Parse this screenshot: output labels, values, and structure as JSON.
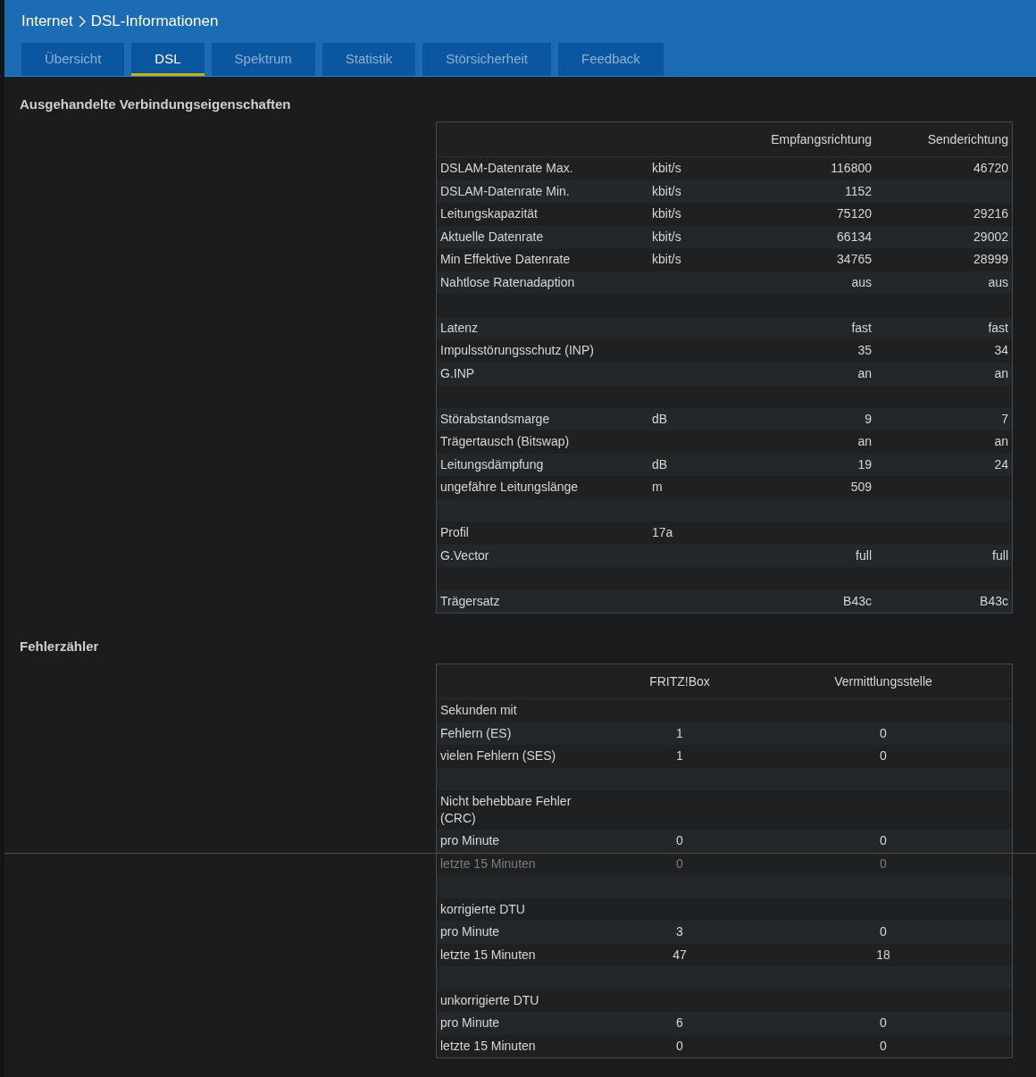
{
  "breadcrumb": {
    "parent": "Internet",
    "current": "DSL-Informationen"
  },
  "tabs": [
    {
      "label": "Übersicht",
      "selected": false
    },
    {
      "label": "DSL",
      "selected": true
    },
    {
      "label": "Spektrum",
      "selected": false
    },
    {
      "label": "Statistik",
      "selected": false
    },
    {
      "label": "Störsicherheit",
      "selected": false
    },
    {
      "label": "Feedback",
      "selected": false
    }
  ],
  "connection": {
    "title": "Ausgehandelte Verbindungseigenschaften",
    "columns": [
      "Empfangsrichtung",
      "Senderichtung"
    ],
    "rows": [
      {
        "kind": "data",
        "label": "DSLAM-Datenrate Max.",
        "unit": "kbit/s",
        "down": "116800",
        "up": "46720"
      },
      {
        "kind": "data",
        "label": "DSLAM-Datenrate Min.",
        "unit": "kbit/s",
        "down": "1152"
      },
      {
        "kind": "data",
        "label": "Leitungskapazität",
        "unit": "kbit/s",
        "down": "75120",
        "up": "29216"
      },
      {
        "kind": "data",
        "label": "Aktuelle Datenrate",
        "unit": "kbit/s",
        "down": "66134",
        "up": "29002"
      },
      {
        "kind": "data",
        "label": "Min Effektive Datenrate",
        "unit": "kbit/s",
        "down": "34765",
        "up": "28999"
      },
      {
        "kind": "data",
        "label": "Nahtlose Ratenadaption",
        "down": "aus",
        "up": "aus"
      },
      {
        "kind": "spacer"
      },
      {
        "kind": "data",
        "label": "Latenz",
        "down": "fast",
        "up": "fast"
      },
      {
        "kind": "data",
        "label": "Impulsstörungsschutz (INP)",
        "down": "35",
        "up": "34"
      },
      {
        "kind": "data",
        "label": "G.INP",
        "down": "an",
        "up": "an"
      },
      {
        "kind": "spacer"
      },
      {
        "kind": "data",
        "label": "Störabstandsmarge",
        "unit": "dB",
        "down": "9",
        "up": "7"
      },
      {
        "kind": "data",
        "label": "Trägertausch (Bitswap)",
        "down": "an",
        "up": "an"
      },
      {
        "kind": "data",
        "label": "Leitungsdämpfung",
        "unit": "dB",
        "down": "19",
        "up": "24"
      },
      {
        "kind": "data",
        "label": "ungefähre Leitungslänge",
        "unit": "m",
        "down": "509"
      },
      {
        "kind": "spacer"
      },
      {
        "kind": "data",
        "label": "Profil",
        "unit": "17a"
      },
      {
        "kind": "data",
        "label": "G.Vector",
        "down": "full",
        "up": "full"
      },
      {
        "kind": "spacer"
      },
      {
        "kind": "data",
        "label": "Trägersatz",
        "down": "B43c",
        "up": "B43c"
      }
    ]
  },
  "errors": {
    "title": "Fehlerzähler",
    "columns": [
      "FRITZ!Box",
      "Vermittlungsstelle"
    ],
    "rows": [
      {
        "kind": "data",
        "label": "Sekunden mit",
        "faded": false
      },
      {
        "kind": "data",
        "label": "Fehlern (ES)",
        "local": "1",
        "remote": "0",
        "faded": false
      },
      {
        "kind": "data",
        "label": "vielen Fehlern (SES)",
        "local": "1",
        "remote": "0",
        "faded": false
      },
      {
        "kind": "spacer"
      },
      {
        "kind": "data",
        "label": "Nicht behebbare Fehler (CRC)",
        "faded": false
      },
      {
        "kind": "data",
        "label": "pro Minute",
        "local": "0",
        "remote": "0",
        "faded": false
      },
      {
        "kind": "data",
        "label": "letzte 15 Minuten",
        "local": "0",
        "remote": "0",
        "faded": true
      },
      {
        "kind": "spacer"
      },
      {
        "kind": "data",
        "label": "korrigierte DTU",
        "faded": false
      },
      {
        "kind": "data",
        "label": "pro Minute",
        "local": "3",
        "remote": "0",
        "faded": false
      },
      {
        "kind": "data",
        "label": "letzte 15 Minuten",
        "local": "47",
        "remote": "18",
        "faded": false
      },
      {
        "kind": "spacer"
      },
      {
        "kind": "data",
        "label": "unkorrigierte DTU",
        "faded": false
      },
      {
        "kind": "data",
        "label": "pro Minute",
        "local": "6",
        "remote": "0",
        "faded": false
      },
      {
        "kind": "data",
        "label": "letzte 15 Minuten",
        "local": "0",
        "remote": "0",
        "faded": false
      }
    ]
  }
}
